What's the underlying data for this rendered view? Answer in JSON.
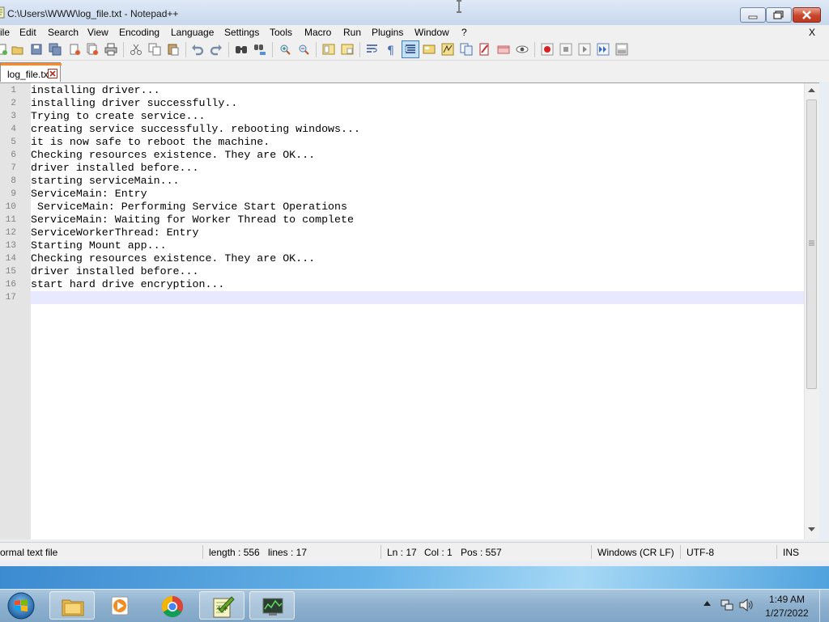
{
  "window": {
    "title": "C:\\Users\\WWW\\log_file.txt - Notepad++"
  },
  "menu": {
    "items": [
      "ile",
      "Edit",
      "Search",
      "View",
      "Encoding",
      "Language",
      "Settings",
      "Tools",
      "Macro",
      "Run",
      "Plugins",
      "Window",
      "?"
    ],
    "close_doc": "X"
  },
  "toolbar": {
    "icons": [
      "new-icon",
      "open-icon",
      "save-icon",
      "save-all-icon",
      "close-icon",
      "close-all-icon",
      "print-icon",
      "cut-icon",
      "copy-icon",
      "paste-icon",
      "undo-icon",
      "redo-icon",
      "find-icon",
      "replace-icon",
      "zoom-in-icon",
      "zoom-out-icon",
      "sync-vertical-icon",
      "sync-horizontal-icon",
      "word-wrap-icon",
      "show-all-chars-icon",
      "indent-guide-icon",
      "lang-icon",
      "folder-doc-icon",
      "function-list-icon",
      "doc-map-icon",
      "shell-icon",
      "monitor-icon",
      "record-macro-icon",
      "stop-macro-icon",
      "play-macro-icon",
      "run-macro-multiple-icon",
      "save-macro-icon"
    ]
  },
  "tab": {
    "label": "log_file.txt"
  },
  "editor": {
    "lines": [
      {
        "n": "1",
        "text": "installing driver..."
      },
      {
        "n": "2",
        "text": "installing driver successfully.."
      },
      {
        "n": "3",
        "text": "Trying to create service..."
      },
      {
        "n": "4",
        "text": "creating service successfully. rebooting windows..."
      },
      {
        "n": "5",
        "text": "it is now safe to reboot the machine."
      },
      {
        "n": "6",
        "text": "Checking resources existence. They are OK..."
      },
      {
        "n": "7",
        "text": "driver installed before..."
      },
      {
        "n": "8",
        "text": "starting serviceMain..."
      },
      {
        "n": "9",
        "text": "ServiceMain: Entry"
      },
      {
        "n": "10",
        "text": " ServiceMain: Performing Service Start Operations"
      },
      {
        "n": "11",
        "text": "ServiceMain: Waiting for Worker Thread to complete"
      },
      {
        "n": "12",
        "text": "ServiceWorkerThread: Entry"
      },
      {
        "n": "13",
        "text": "Starting Mount app..."
      },
      {
        "n": "14",
        "text": "Checking resources existence. They are OK..."
      },
      {
        "n": "15",
        "text": "driver installed before..."
      },
      {
        "n": "16",
        "text": "start hard drive encryption..."
      },
      {
        "n": "17",
        "text": ""
      }
    ]
  },
  "status": {
    "file_type": "ormal text file",
    "length": "length : 556",
    "lines": "lines : 17",
    "ln": "Ln : 17",
    "col": "Col : 1",
    "pos": "Pos : 557",
    "eol": "Windows (CR LF)",
    "encoding": "UTF-8",
    "mode": "INS"
  },
  "taskbar": {
    "apps": [
      "file-explorer-icon",
      "media-player-icon",
      "chrome-icon",
      "notepad-plus-plus-icon",
      "task-manager-icon"
    ],
    "clock_time": "1:49 AM",
    "clock_date": "1/27/2022"
  },
  "colors": {
    "tab_accent": "#fa8a2a",
    "gutter_bg": "#e4e4e4",
    "current_line": "#e8e8ff",
    "close_button": "#c8442b",
    "taskbar": "#8fb1cf"
  }
}
